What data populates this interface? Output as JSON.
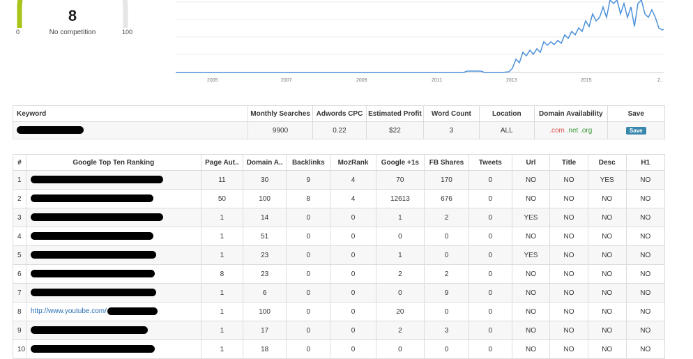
{
  "gauge": {
    "value": "8",
    "label": "No competition",
    "min": "0",
    "max": "100",
    "level": 0.08,
    "color": "#a8c41a"
  },
  "trend": {
    "x_labels": [
      "2005",
      "2007",
      "2009",
      "2011",
      "2013",
      "2015",
      "2.."
    ],
    "line_color": "#4a90d9"
  },
  "keyword_table": {
    "headers": [
      "Keyword",
      "Monthly Searches",
      "Adwords CPC",
      "Estimated Profit",
      "Word Count",
      "Location",
      "Domain Availability",
      "Save"
    ],
    "row": {
      "monthly_searches": "9900",
      "adwords_cpc": "0.22",
      "estimated_profit": "$22",
      "word_count": "3",
      "location": "ALL",
      "tld_com": ".com",
      "tld_net": ".net",
      "tld_org": ".org",
      "save_label": "Save"
    }
  },
  "ranking_table": {
    "headers": [
      "#",
      "Google Top Ten Ranking",
      "Page Aut..",
      "Domain A..",
      "Backlinks",
      "MozRank",
      "Google +1s",
      "FB Shares",
      "Tweets",
      "Url",
      "Title",
      "Desc",
      "H1"
    ],
    "rows": [
      {
        "n": "1",
        "url": "",
        "pa": "11",
        "da": "30",
        "bl": "9",
        "mr": "4",
        "g1": "70",
        "fb": "170",
        "tw": "0",
        "u": "NO",
        "t": "NO",
        "d": "YES",
        "h": "NO"
      },
      {
        "n": "2",
        "url": "",
        "pa": "50",
        "da": "100",
        "bl": "8",
        "mr": "4",
        "g1": "12613",
        "fb": "676",
        "tw": "0",
        "u": "NO",
        "t": "NO",
        "d": "NO",
        "h": "NO"
      },
      {
        "n": "3",
        "url": "",
        "pa": "1",
        "da": "14",
        "bl": "0",
        "mr": "0",
        "g1": "1",
        "fb": "2",
        "tw": "0",
        "u": "YES",
        "t": "NO",
        "d": "NO",
        "h": "NO"
      },
      {
        "n": "4",
        "url": "",
        "pa": "1",
        "da": "51",
        "bl": "0",
        "mr": "0",
        "g1": "0",
        "fb": "0",
        "tw": "0",
        "u": "NO",
        "t": "NO",
        "d": "NO",
        "h": "NO"
      },
      {
        "n": "5",
        "url": "",
        "pa": "1",
        "da": "23",
        "bl": "0",
        "mr": "0",
        "g1": "1",
        "fb": "0",
        "tw": "0",
        "u": "YES",
        "t": "NO",
        "d": "NO",
        "h": "NO"
      },
      {
        "n": "6",
        "url": "",
        "pa": "8",
        "da": "23",
        "bl": "0",
        "mr": "0",
        "g1": "2",
        "fb": "2",
        "tw": "0",
        "u": "NO",
        "t": "NO",
        "d": "NO",
        "h": "NO"
      },
      {
        "n": "7",
        "url": "",
        "pa": "1",
        "da": "6",
        "bl": "0",
        "mr": "0",
        "g1": "0",
        "fb": "9",
        "tw": "0",
        "u": "NO",
        "t": "NO",
        "d": "NO",
        "h": "NO"
      },
      {
        "n": "8",
        "url": "http://www.youtube.com/",
        "pa": "1",
        "da": "100",
        "bl": "0",
        "mr": "0",
        "g1": "20",
        "fb": "0",
        "tw": "0",
        "u": "NO",
        "t": "NO",
        "d": "NO",
        "h": "NO"
      },
      {
        "n": "9",
        "url": "",
        "pa": "1",
        "da": "17",
        "bl": "0",
        "mr": "0",
        "g1": "2",
        "fb": "3",
        "tw": "0",
        "u": "NO",
        "t": "NO",
        "d": "NO",
        "h": "NO"
      },
      {
        "n": "10",
        "url": "",
        "pa": "1",
        "da": "18",
        "bl": "0",
        "mr": "0",
        "g1": "0",
        "fb": "0",
        "tw": "0",
        "u": "NO",
        "t": "NO",
        "d": "NO",
        "h": "NO"
      }
    ]
  }
}
